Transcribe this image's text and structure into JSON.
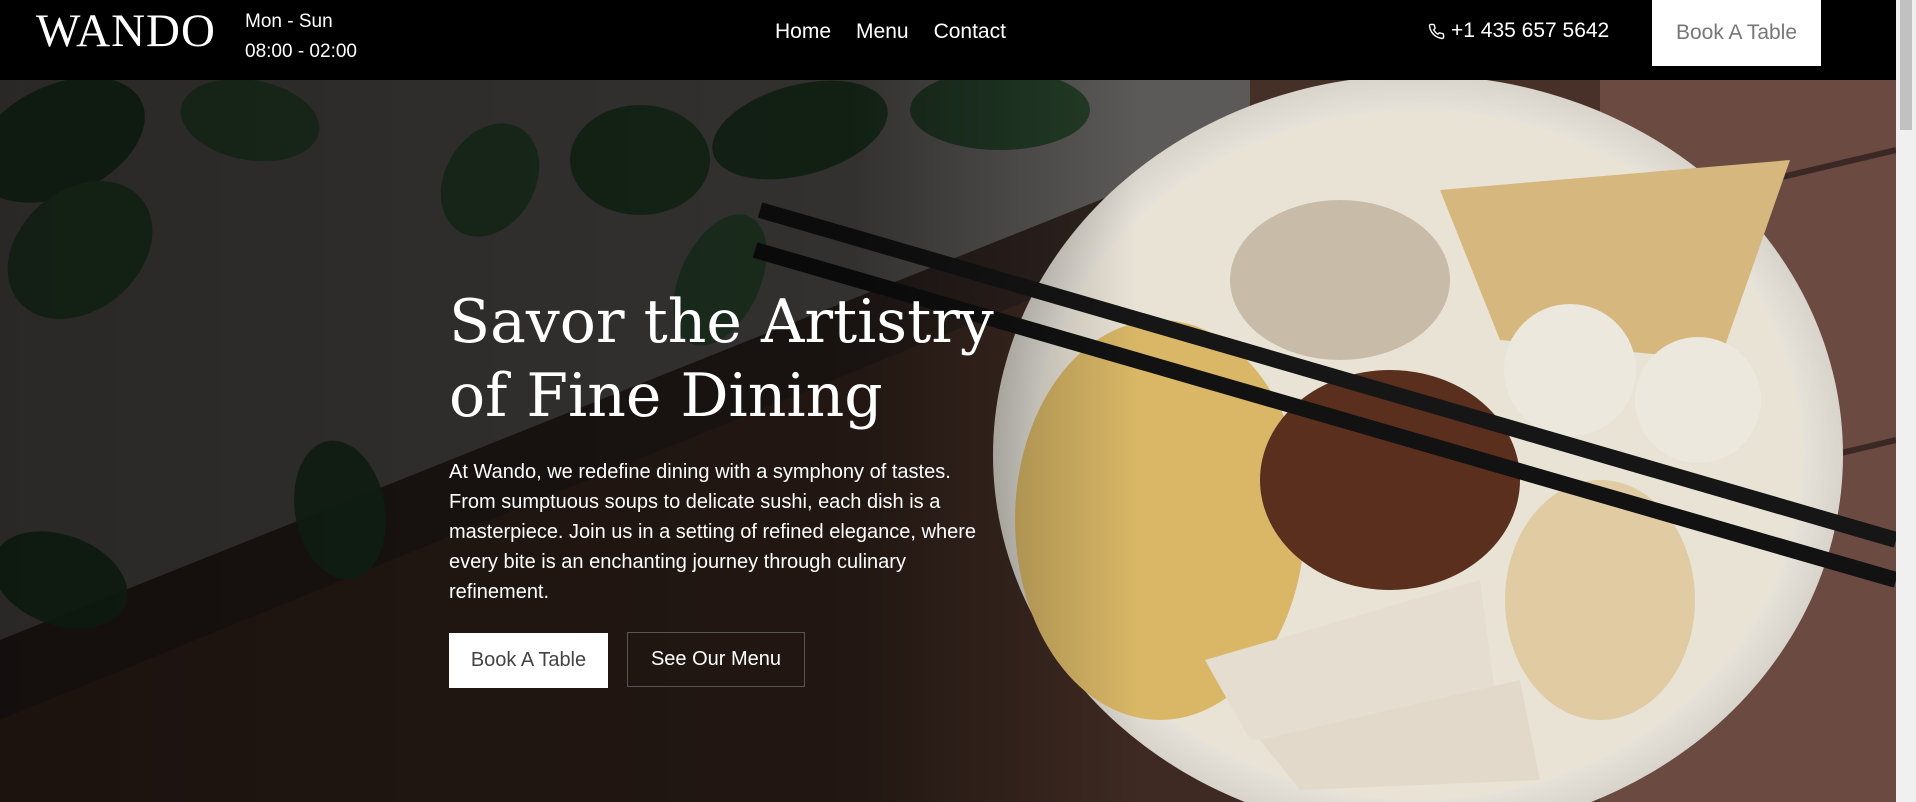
{
  "brand": {
    "logo": "WANDO"
  },
  "hours": {
    "days": "Mon - Sun",
    "time": "08:00 - 02:00"
  },
  "nav": {
    "items": [
      "Home",
      "Menu",
      "Contact"
    ]
  },
  "contact": {
    "phone": "+1 435 657 5642",
    "icon": "phone-icon"
  },
  "header": {
    "cta_label": "Book A Table"
  },
  "hero": {
    "title": "Savor the Artistry of Fine Dining",
    "description": "At Wando, we redefine dining with a symphony of tastes. From sumptuous soups to delicate sushi, each dish is a masterpiece. Join us in a setting of refined elegance, where every bite is an enchanting journey through culinary refinement.",
    "primary_cta": "Book A Table",
    "secondary_cta": "See Our Menu"
  },
  "colors": {
    "header_bg": "#000000",
    "button_bg": "#ffffff",
    "text": "#ffffff"
  }
}
